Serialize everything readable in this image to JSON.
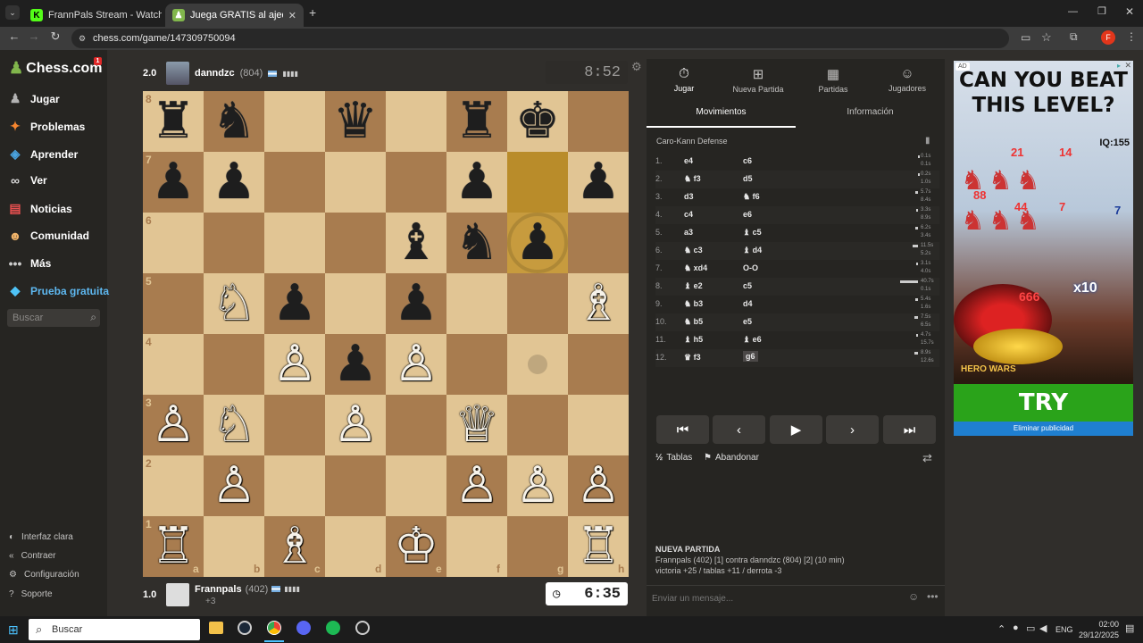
{
  "browser": {
    "tabs": [
      {
        "title": "FrannPals Stream - Watch Live o",
        "active": false
      },
      {
        "title": "Juega GRATIS al ajedrez online",
        "active": true
      }
    ],
    "url": "chess.com/game/147309750094"
  },
  "sidebar": {
    "logo": "Chess.com",
    "badge": "1",
    "items": [
      {
        "label": "Jugar",
        "icon": "play-icon"
      },
      {
        "label": "Problemas",
        "icon": "puzzle-icon"
      },
      {
        "label": "Aprender",
        "icon": "learn-icon"
      },
      {
        "label": "Ver",
        "icon": "binoculars-icon"
      },
      {
        "label": "Noticias",
        "icon": "news-icon"
      },
      {
        "label": "Comunidad",
        "icon": "community-icon"
      },
      {
        "label": "Más",
        "icon": "more-icon"
      },
      {
        "label": "Prueba gratuita",
        "icon": "diamond-icon"
      }
    ],
    "search_placeholder": "Buscar",
    "bottom": [
      {
        "label": "Interfaz clara"
      },
      {
        "label": "Contraer"
      },
      {
        "label": "Configuración"
      },
      {
        "label": "Soporte"
      }
    ]
  },
  "top_player": {
    "name": "danndzc",
    "rating": "(804)",
    "score": "2.0",
    "clock": "8:52"
  },
  "bottom_player": {
    "name": "Frannpals",
    "rating": "(402)",
    "score": "1.0",
    "clock": "6:35",
    "material": "+3"
  },
  "board": {
    "ranks": [
      "8",
      "7",
      "6",
      "5",
      "4",
      "3",
      "2",
      "1"
    ],
    "files": [
      "a",
      "b",
      "c",
      "d",
      "e",
      "f",
      "g",
      "h"
    ],
    "pieces": [
      {
        "sq": "a8",
        "p": "♜",
        "c": "b"
      },
      {
        "sq": "b8",
        "p": "♞",
        "c": "b"
      },
      {
        "sq": "d8",
        "p": "♛",
        "c": "b"
      },
      {
        "sq": "f8",
        "p": "♜",
        "c": "b"
      },
      {
        "sq": "g8",
        "p": "♚",
        "c": "b"
      },
      {
        "sq": "a7",
        "p": "♟",
        "c": "b"
      },
      {
        "sq": "b7",
        "p": "♟",
        "c": "b"
      },
      {
        "sq": "f7",
        "p": "♟",
        "c": "b"
      },
      {
        "sq": "h7",
        "p": "♟",
        "c": "b"
      },
      {
        "sq": "e6",
        "p": "♝",
        "c": "b"
      },
      {
        "sq": "f6",
        "p": "♞",
        "c": "b"
      },
      {
        "sq": "g6",
        "p": "♟",
        "c": "b"
      },
      {
        "sq": "b5",
        "p": "♘",
        "c": "w"
      },
      {
        "sq": "c5",
        "p": "♟",
        "c": "b"
      },
      {
        "sq": "e5",
        "p": "♟",
        "c": "b"
      },
      {
        "sq": "h5",
        "p": "♗",
        "c": "w"
      },
      {
        "sq": "c4",
        "p": "♙",
        "c": "w"
      },
      {
        "sq": "d4",
        "p": "♟",
        "c": "b"
      },
      {
        "sq": "e4",
        "p": "♙",
        "c": "w"
      },
      {
        "sq": "a3",
        "p": "♙",
        "c": "w"
      },
      {
        "sq": "b3",
        "p": "♘",
        "c": "w"
      },
      {
        "sq": "d3",
        "p": "♙",
        "c": "w"
      },
      {
        "sq": "f3",
        "p": "♕",
        "c": "w"
      },
      {
        "sq": "b2",
        "p": "♙",
        "c": "w"
      },
      {
        "sq": "f2",
        "p": "♙",
        "c": "w"
      },
      {
        "sq": "g2",
        "p": "♙",
        "c": "w"
      },
      {
        "sq": "h2",
        "p": "♙",
        "c": "w"
      },
      {
        "sq": "a1",
        "p": "♖",
        "c": "w"
      },
      {
        "sq": "c1",
        "p": "♗",
        "c": "w"
      },
      {
        "sq": "e1",
        "p": "♔",
        "c": "w"
      },
      {
        "sq": "h1",
        "p": "♖",
        "c": "w"
      }
    ],
    "highlight": [
      "g7",
      "g6"
    ]
  },
  "panel": {
    "tabs": [
      "Jugar",
      "Nueva Partida",
      "Partidas",
      "Jugadores"
    ],
    "subtabs": [
      "Movimientos",
      "Información"
    ],
    "opening": "Caro-Kann Defense",
    "moves": [
      {
        "n": "1.",
        "w": "e4",
        "b": "c6",
        "t1": "0.1s",
        "t2": "0.1s"
      },
      {
        "n": "2.",
        "w": "f3",
        "wi": "♞",
        "b": "d5",
        "t1": "0.2s",
        "t2": "1.0s"
      },
      {
        "n": "3.",
        "w": "d3",
        "b": "f6",
        "bi": "♞",
        "t1": "5.7s",
        "t2": "8.4s"
      },
      {
        "n": "4.",
        "w": "c4",
        "b": "e6",
        "t1": "3.3s",
        "t2": "8.9s"
      },
      {
        "n": "5.",
        "w": "a3",
        "b": "c5",
        "bi": "♝",
        "t1": "6.2s",
        "t2": "3.4s"
      },
      {
        "n": "6.",
        "w": "c3",
        "wi": "♞",
        "b": "d4",
        "bi": "♝",
        "t1": "11.5s",
        "t2": "5.2s"
      },
      {
        "n": "7.",
        "w": "xd4",
        "wi": "♞",
        "b": "O-O",
        "t1": "3.1s",
        "t2": "4.0s"
      },
      {
        "n": "8.",
        "w": "e2",
        "wi": "♝",
        "b": "c5",
        "t1": "40.7s",
        "t2": "0.1s"
      },
      {
        "n": "9.",
        "w": "b3",
        "wi": "♞",
        "b": "d4",
        "t1": "5.4s",
        "t2": "1.6s"
      },
      {
        "n": "10.",
        "w": "b5",
        "wi": "♞",
        "b": "e5",
        "t1": "7.5s",
        "t2": "6.5s"
      },
      {
        "n": "11.",
        "w": "h5",
        "wi": "♝",
        "b": "e6",
        "bi": "♝",
        "t1": "4.7s",
        "t2": "15.7s"
      },
      {
        "n": "12.",
        "w": "f3",
        "wi": "♛",
        "b": "g6",
        "t1": "8.9s",
        "t2": "12.6s"
      }
    ],
    "draw": "Tablas",
    "resign": "Abandonar",
    "new_game": {
      "title": "NUEVA PARTIDA",
      "line1": "Frannpals (402) [1] contra danndzc (804) [2] (10 min)",
      "line2": "victoria +25 / tablas +11 / derrota -3"
    },
    "chat_placeholder": "Enviar un mensaje..."
  },
  "ad": {
    "label": "AD",
    "headline1": "CAN YOU BEAT",
    "headline2": "THIS LEVEL?",
    "iq": "IQ:155",
    "numbers": [
      "21",
      "14",
      "88",
      "44",
      "7",
      "7",
      "666",
      "x10"
    ],
    "brand": "HERO WARS",
    "cta": "TRY",
    "remove": "Eliminar publicidad"
  },
  "taskbar": {
    "search": "Buscar",
    "lang": "ENG",
    "time": "02:00",
    "date": "29/12/2025"
  }
}
